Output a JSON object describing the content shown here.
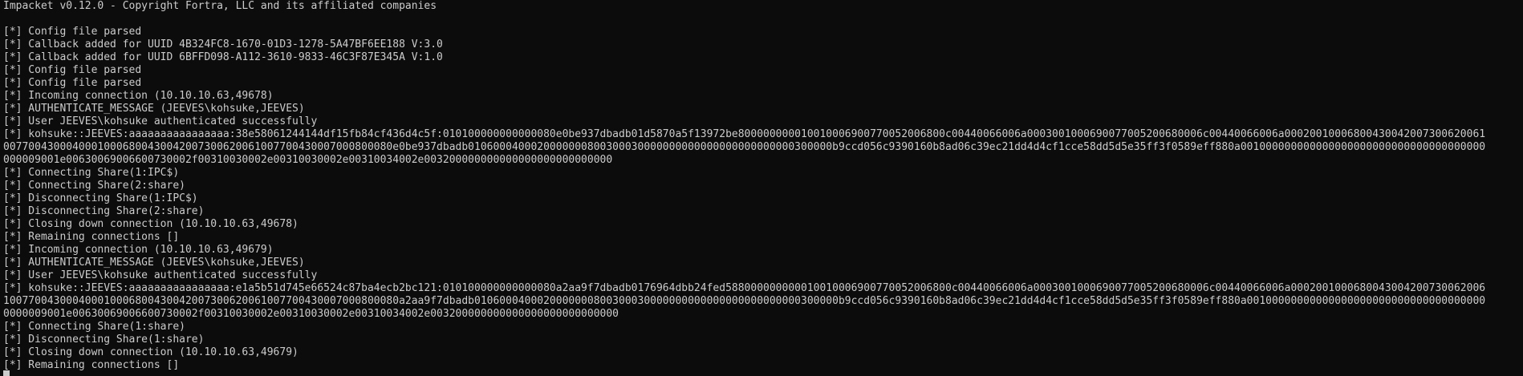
{
  "terminal": {
    "lines": [
      "Impacket v0.12.0 - Copyright Fortra, LLC and its affiliated companies",
      "",
      "[*] Config file parsed",
      "[*] Callback added for UUID 4B324FC8-1670-01D3-1278-5A47BF6EE188 V:3.0",
      "[*] Callback added for UUID 6BFFD098-A112-3610-9833-46C3F87E345A V:1.0",
      "[*] Config file parsed",
      "[*] Config file parsed",
      "[*] Incoming connection (10.10.10.63,49678)",
      "[*] AUTHENTICATE_MESSAGE (JEEVES\\kohsuke,JEEVES)",
      "[*] User JEEVES\\kohsuke authenticated successfully",
      "[*] kohsuke::JEEVES:aaaaaaaaaaaaaaaa:38e58061244144df15fb84cf436d4c5f:010100000000000080e0be937dbadb01d5870a5f13972be800000000010010006900770052006800c00440066006a0003001000690077005200680006c00440066006a0002001000680043004200730062006100770043000400010006800430042007300620061007700430007000800080e0be937dbadb0106000400020000000800300030000000000000000000000000300000b9ccd056c9390160b8ad06c39ec21dd4d4cf1cce58dd5d5e35ff3f0589eff880a001000000000000000000000000000000000000000009001e00630069006600730002f00310030002e00310030002e00310034002e003200000000000000000000000000",
      "[*] Connecting Share(1:IPC$)",
      "[*] Connecting Share(2:share)",
      "[*] Disconnecting Share(1:IPC$)",
      "[*] Disconnecting Share(2:share)",
      "[*] Closing down connection (10.10.10.63,49678)",
      "[*] Remaining connections []",
      "[*] Incoming connection (10.10.10.63,49679)",
      "[*] AUTHENTICATE_MESSAGE (JEEVES\\kohsuke,JEEVES)",
      "[*] User JEEVES\\kohsuke authenticated successfully",
      "[*] kohsuke::JEEVES:aaaaaaaaaaaaaaaa:e1a5b51d745e66524c87ba4ecb2bc121:010100000000000080a2aa9f7dbadb0176964dbb24fed588000000000010010006900770052006800c00440066006a0003001000690077005200680006c00440066006a0002001000680043004200730062006100770043000400010006800430042007300620061007700430007000800080a2aa9f7dbadb0106000400020000000800300030000000000000000000000000300000b9ccd056c9390160b8ad06c39ec21dd4d4cf1cce58dd5d5e35ff3f0589eff880a001000000000000000000000000000000000000000009001e00630069006600730002f00310030002e00310030002e00310034002e003200000000000000000000000000",
      "[*] Connecting Share(1:share)",
      "[*] Disconnecting Share(1:share)",
      "[*] Closing down connection (10.10.10.63,49679)",
      "[*] Remaining connections []"
    ],
    "wrap_columns": 236,
    "colors": {
      "background": "#0c0c0c",
      "foreground": "#cccccc",
      "cursor": "#cccccc"
    }
  }
}
